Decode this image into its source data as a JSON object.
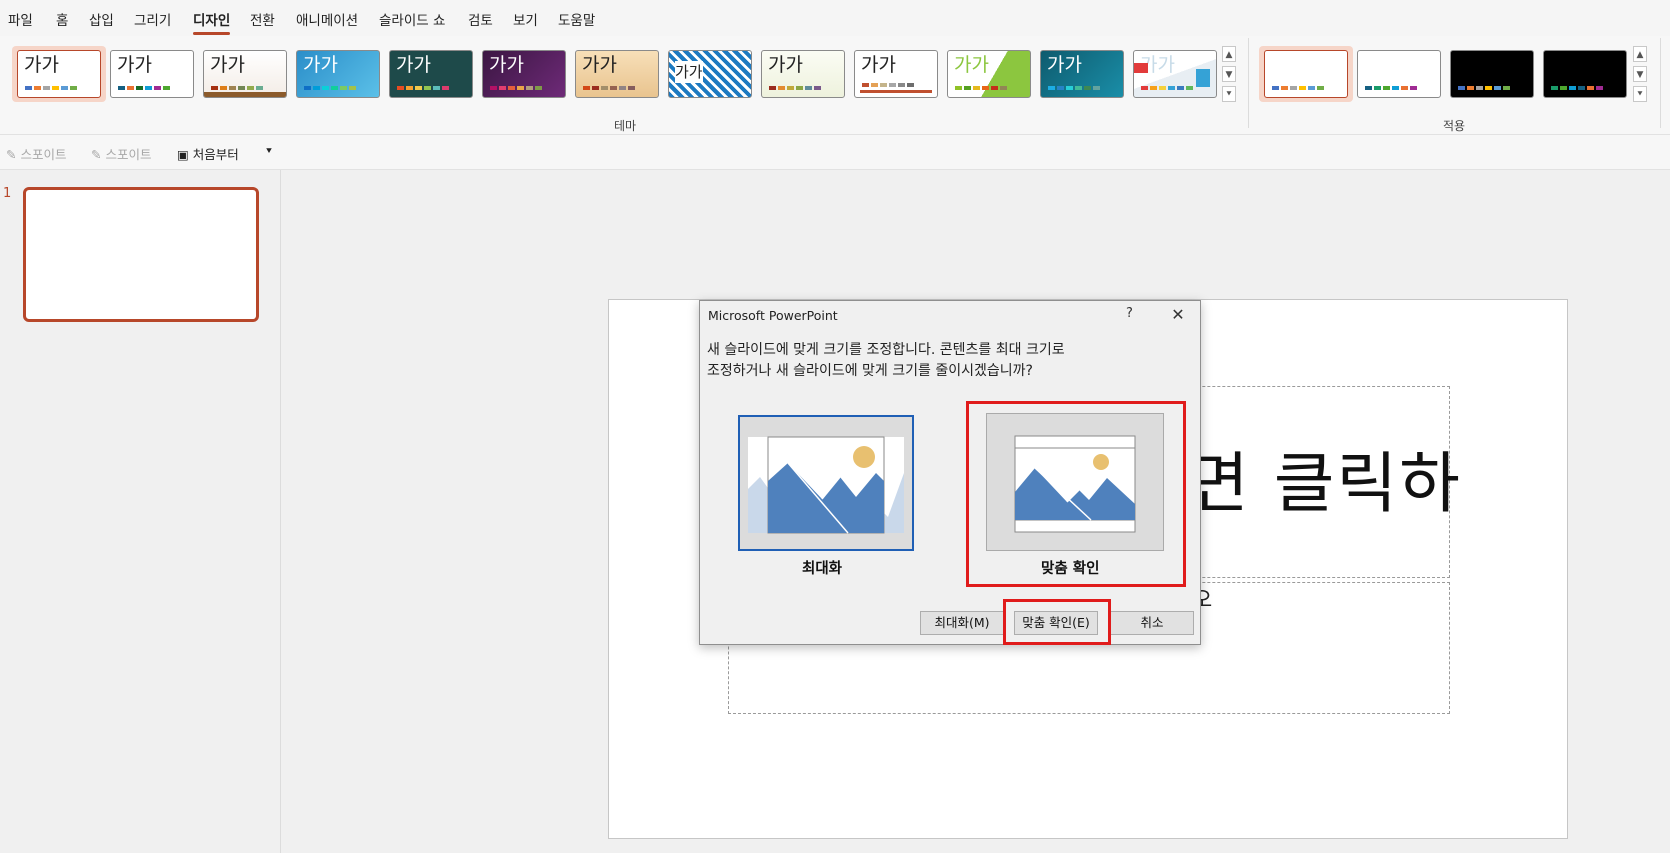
{
  "menu": {
    "items": [
      {
        "label": "파일"
      },
      {
        "label": "홈"
      },
      {
        "label": "삽입"
      },
      {
        "label": "그리기"
      },
      {
        "label": "디자인",
        "active": true
      },
      {
        "label": "전환"
      },
      {
        "label": "애니메이션"
      },
      {
        "label": "슬라이드 쇼"
      },
      {
        "label": "검토"
      },
      {
        "label": "보기"
      },
      {
        "label": "도움말"
      }
    ]
  },
  "ribbon": {
    "theme_sample_text": "가가",
    "themes_group_label": "테마",
    "variants_group_label": "적용",
    "colors": {
      "accent": "#b7472a",
      "selected_bg": "#f6d5c8"
    }
  },
  "qat": {
    "eyedropper1": "스포이트",
    "eyedropper2": "스포이트",
    "from_beginning": "처음부터"
  },
  "slide_pane": {
    "slide_number": "1"
  },
  "slide": {
    "title_fragment": "면 클릭하",
    "subtitle_fragment": "오"
  },
  "dialog": {
    "title": "Microsoft PowerPoint",
    "help": "?",
    "message_line1": "새 슬라이드에 맞게 크기를 조정합니다. 콘텐츠를 최대 크기로",
    "message_line2": "조정하거나 새 슬라이드에 맞게 크기를 줄이시겠습니까?",
    "option_maximize": "최대화",
    "option_fit": "맞춤 확인",
    "btn_maximize": "최대화(M)",
    "btn_fit": "맞춤 확인(E)",
    "btn_cancel": "취소"
  }
}
